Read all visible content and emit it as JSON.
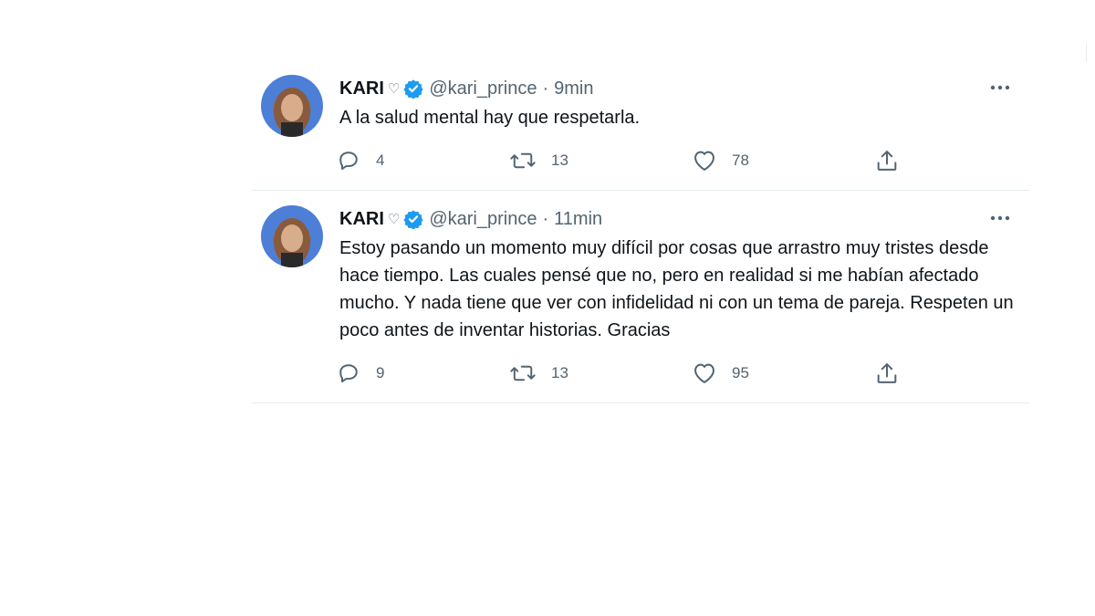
{
  "tweets": [
    {
      "name": "KARI",
      "name_suffix": "♡",
      "handle": "@kari_prince",
      "separator": "·",
      "time": "9min",
      "text": "A la salud mental hay que respetarla.",
      "replies": "4",
      "retweets": "13",
      "likes": "78"
    },
    {
      "name": "KARI",
      "name_suffix": "♡",
      "handle": "@kari_prince",
      "separator": "·",
      "time": "11min",
      "text": "Estoy pasando un momento muy difícil  por cosas que arrastro muy tristes desde hace tiempo. Las cuales pensé que no, pero en realidad si me habían afectado mucho. Y nada tiene que ver con infidelidad ni con un tema de pareja. Respeten un poco antes de inventar historias. Gracias",
      "replies": "9",
      "retweets": "13",
      "likes": "95"
    }
  ],
  "icons": {
    "more": "more-horizontal-icon",
    "verified": "verified-badge-icon",
    "reply": "reply-icon",
    "retweet": "retweet-icon",
    "like": "heart-icon",
    "share": "share-icon"
  },
  "colors": {
    "verified": "#1d9bf0",
    "secondary_text": "#536471",
    "primary_text": "#0f1419",
    "divider": "#e6ecf0"
  }
}
